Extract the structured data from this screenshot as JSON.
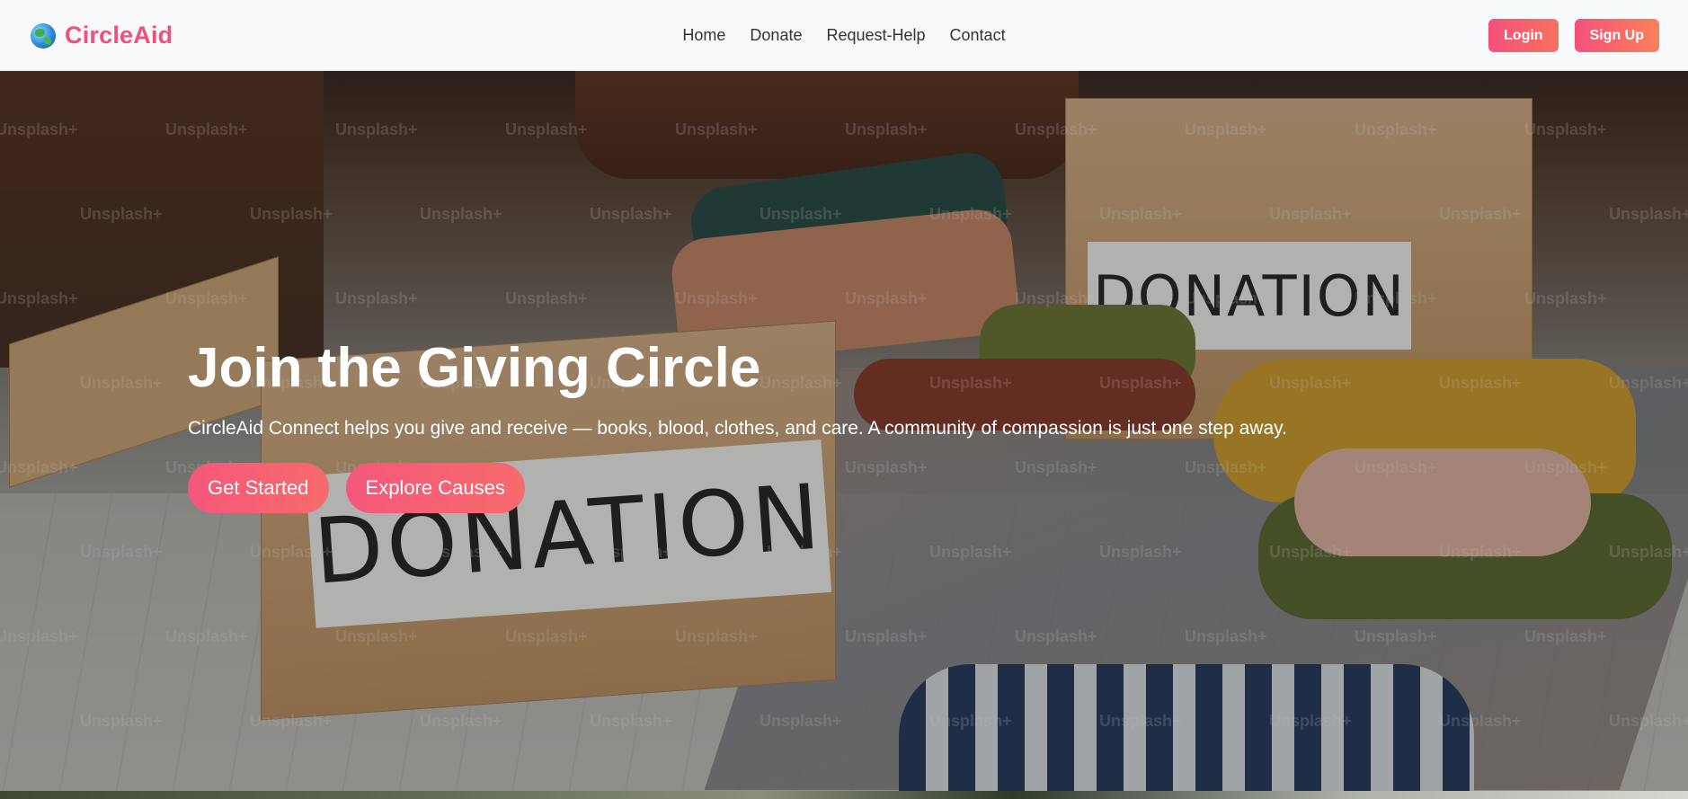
{
  "navbar": {
    "brand": "CircleAid",
    "links": [
      "Home",
      "Donate",
      "Request-Help",
      "Contact"
    ],
    "login_label": "Login",
    "signup_label": "Sign Up"
  },
  "hero": {
    "title": "Join the Giving Circle",
    "subtitle": "CircleAid Connect helps you give and receive — books, blood, clothes, and care. A community of compassion is just one step away.",
    "buttons": [
      "Get Started",
      "Explore Causes"
    ],
    "image": {
      "box_label_front": "DONATION",
      "box_label_back": "DONATION",
      "watermark": "Unsplash+"
    }
  },
  "colors": {
    "brand": "#f0507a",
    "button_gradient_start": "#f5507a",
    "button_gradient_end": "#f7725f",
    "navbar_bg": "#f8f9fa"
  },
  "icons": {
    "logo": "globe-icon"
  }
}
